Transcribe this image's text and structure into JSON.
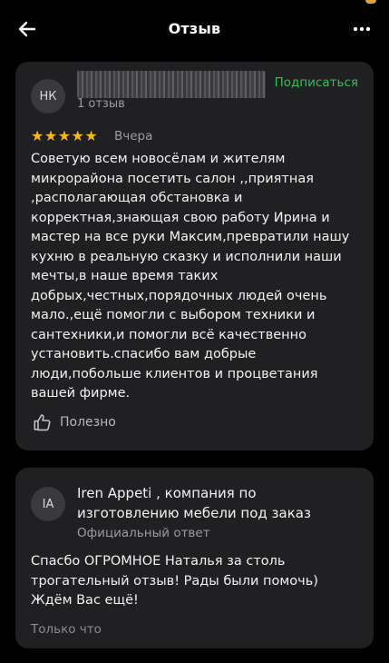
{
  "header": {
    "title": "Отзыв",
    "back_icon": "arrow-left-icon",
    "more_icon": "more-dots-icon"
  },
  "review": {
    "avatar_initials": "НК",
    "reviews_count": "1 отзыв",
    "subscribe_label": "Подписаться",
    "rating": 5,
    "stars": "★★★★★",
    "date": "Вчера",
    "text": "Советую всем новосёлам и жителям микрорайона посетить салон ,,приятная ,располагающая обстановка и корректная,знающая свою работу Ирина и мастер на все руки Максим,превратили нашу кухню в реальную сказку и исполнили наши мечты,в наше время таких добрых,честных,порядочных людей очень мало.,ещё помогли с выбором техники и сантехники,и помогли всё качественно установить.спасибо вам добрые люди,побольше клиентов и процветания вашей фирме.",
    "useful_label": "Полезно",
    "useful_icon": "thumbs-up-icon"
  },
  "reply": {
    "avatar_initials": "IA",
    "company": "Iren Appeti , компания по изготовлению мебели под заказ",
    "official_label": "Официальный ответ",
    "text": "Спасбо ОГРОМНОЕ Наталья за столь трогательный отзыв! Рады были помочь) Ждём Вас ещё!",
    "time": "Только что"
  },
  "colors": {
    "background": "#000000",
    "card": "#202022",
    "accent_green": "#3bbd5a",
    "star": "#f5b81c",
    "muted_text": "#9c9ca1"
  }
}
